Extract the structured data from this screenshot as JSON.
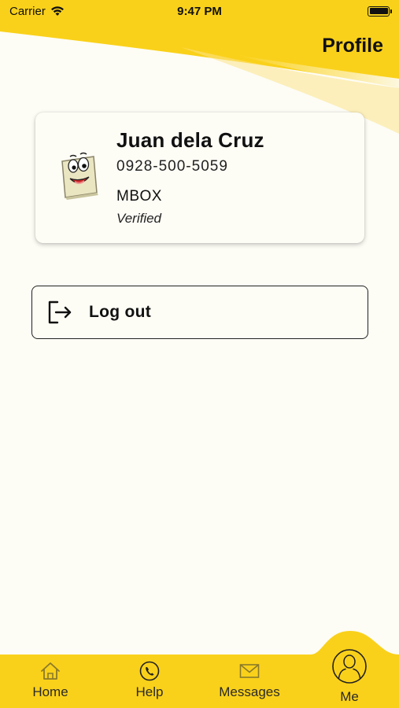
{
  "status_bar": {
    "carrier": "Carrier",
    "time": "9:47 PM"
  },
  "header": {
    "title": "Profile"
  },
  "profile": {
    "name": "Juan dela Cruz",
    "phone": "0928-500-5059",
    "account": "MBOX",
    "status": "Verified"
  },
  "logout": {
    "label": "Log out"
  },
  "tabs": [
    {
      "label": "Home",
      "icon": "home-icon"
    },
    {
      "label": "Help",
      "icon": "phone-icon"
    },
    {
      "label": "Messages",
      "icon": "envelope-icon"
    },
    {
      "label": "Me",
      "icon": "user-icon"
    }
  ],
  "colors": {
    "accent": "#fad11a",
    "background": "#fdfcf5",
    "text": "#111111",
    "tab_icon": "#8a7a2a"
  }
}
